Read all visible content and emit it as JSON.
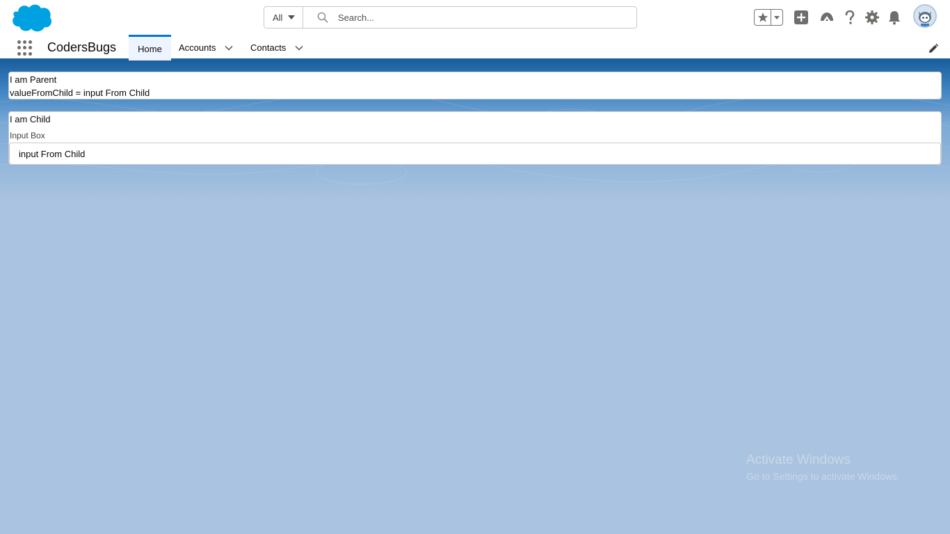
{
  "header": {
    "logo": "salesforce-cloud-logo",
    "search_scope": "All",
    "search_placeholder": "Search...",
    "icons": [
      "star-icon",
      "chevron-down-icon",
      "plus-icon",
      "trailhead-icon",
      "help-icon",
      "gear-icon",
      "bell-icon",
      "avatar"
    ]
  },
  "nav": {
    "app_name": "CodersBugs",
    "tabs": [
      {
        "label": "Home",
        "active": true
      },
      {
        "label": "Accounts",
        "has_menu": true
      },
      {
        "label": "Contacts",
        "has_menu": true
      }
    ]
  },
  "parent": {
    "title": "I am Parent",
    "value_line": "valueFromChild = input From Child"
  },
  "child": {
    "title": "I am Child",
    "input_label": "Input Box",
    "input_value": "input From Child"
  },
  "watermark": {
    "title": "Activate Windows",
    "subtitle": "Go to Settings to activate Windows."
  },
  "colors": {
    "brand_blue": "#0176d3",
    "header_band": "#1b5f9e",
    "page_bg": "#a9c3e0",
    "logo_blue": "#00a1e0"
  }
}
